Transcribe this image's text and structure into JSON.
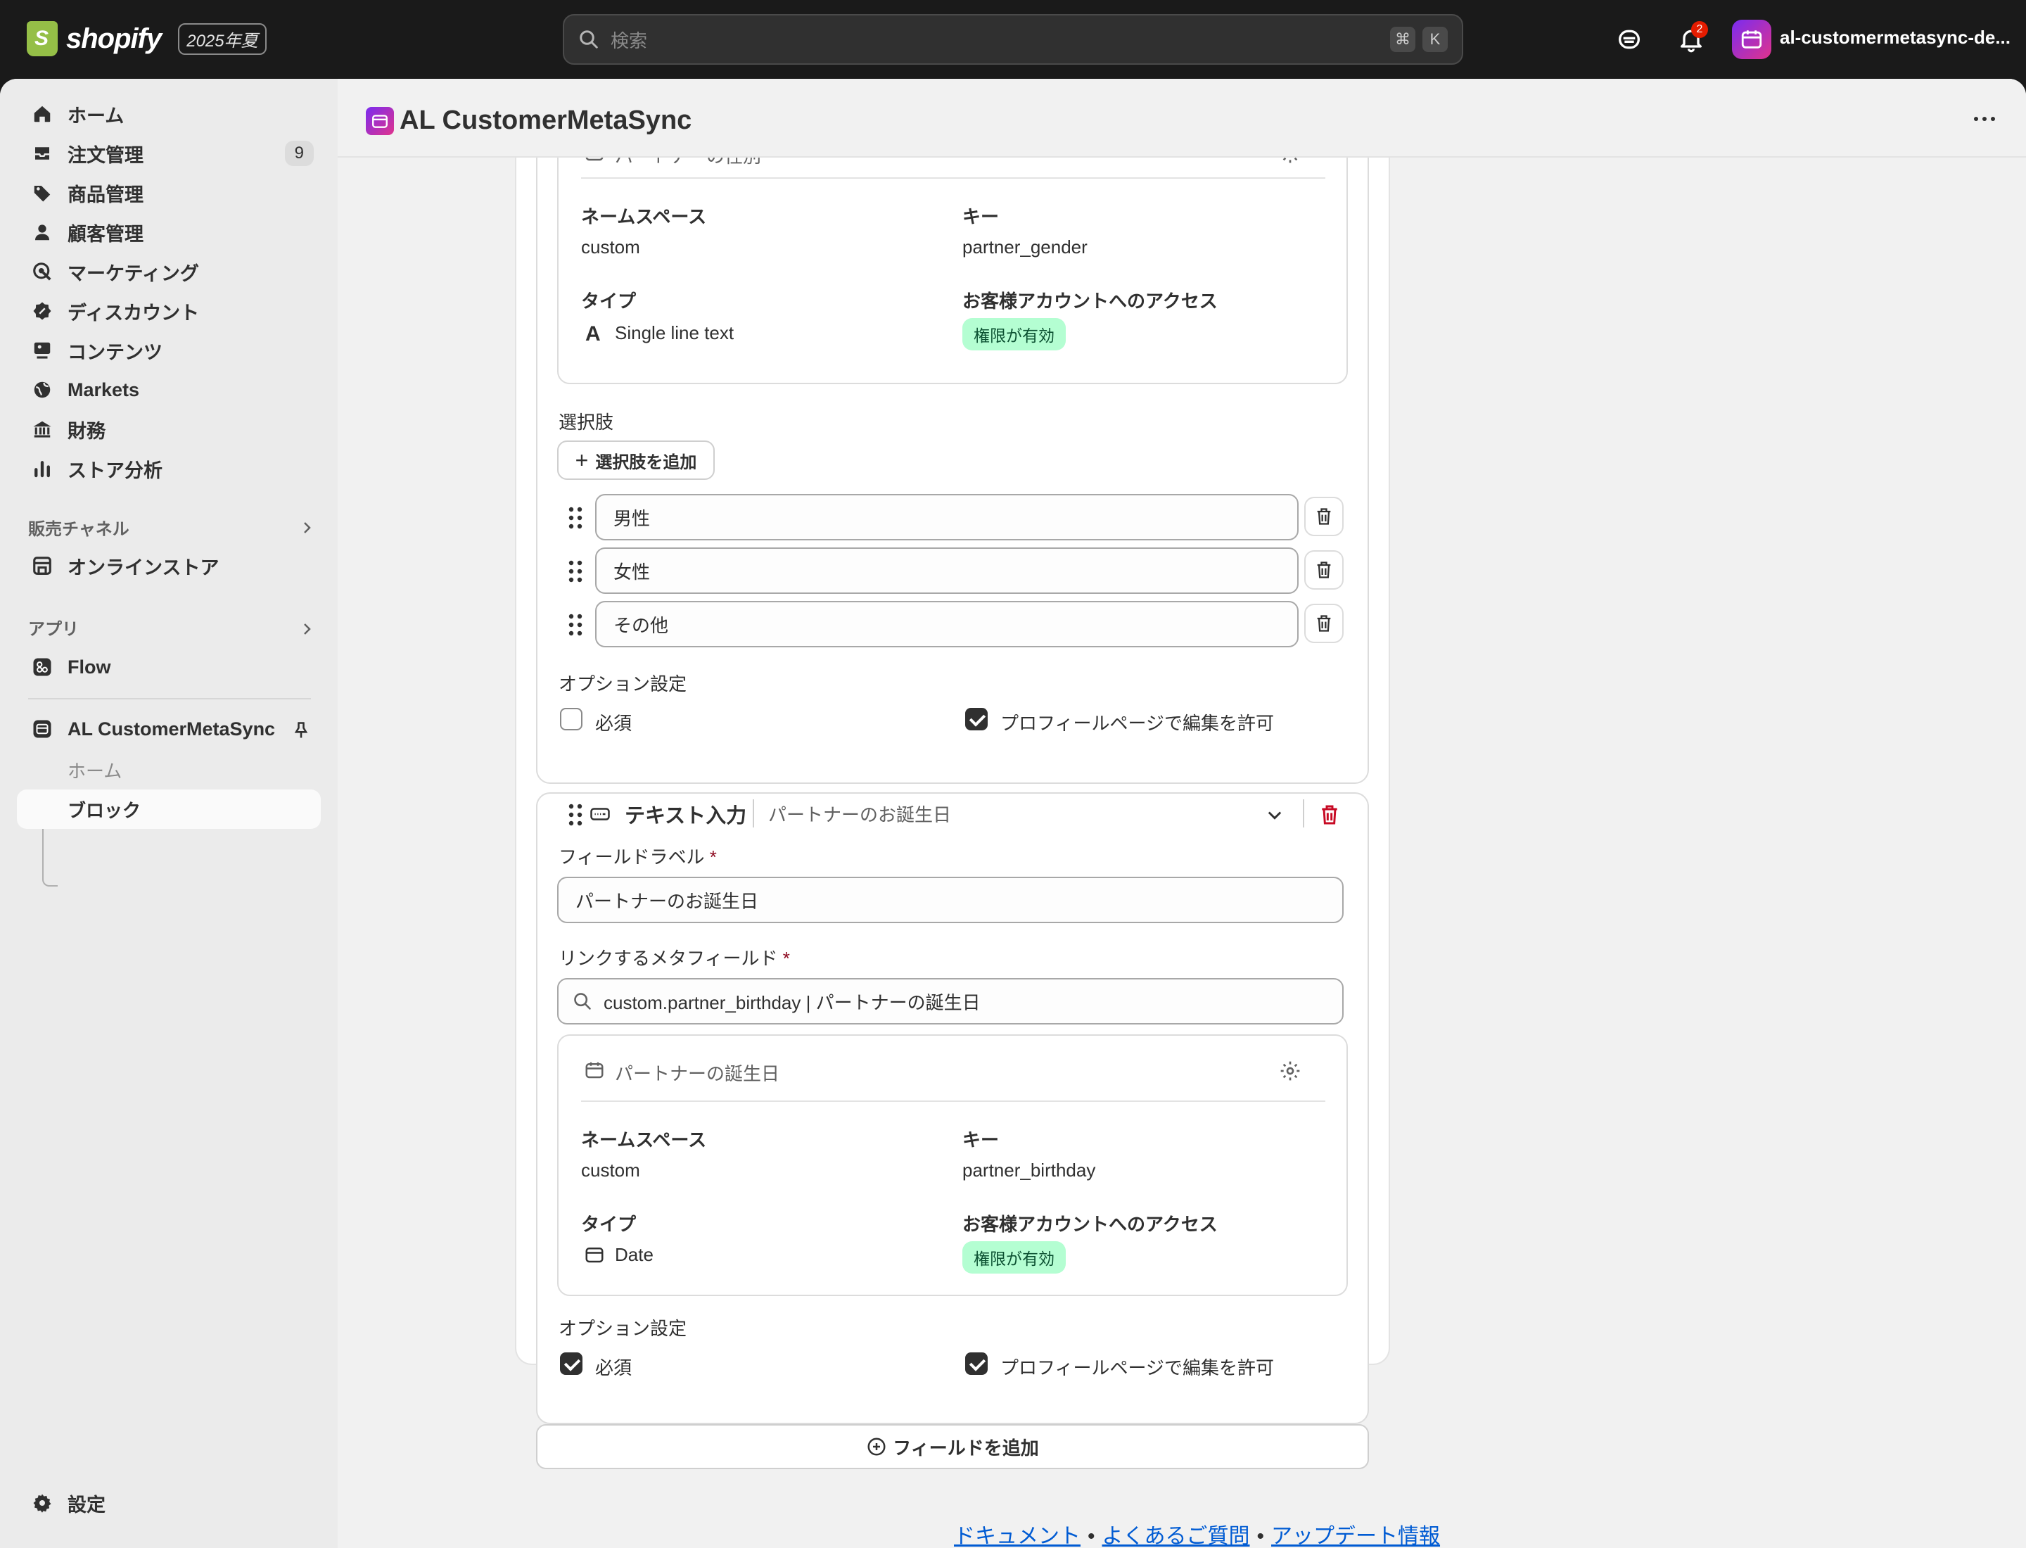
{
  "topbar": {
    "brand": "shopify",
    "edition": "2025年夏",
    "search_placeholder": "検索",
    "kbd1": "⌘",
    "kbd2": "K",
    "notification_count": "2",
    "store_name": "al-customermetasync-de..."
  },
  "sidebar": {
    "items": [
      {
        "label": "ホーム"
      },
      {
        "label": "注文管理",
        "count": "9"
      },
      {
        "label": "商品管理"
      },
      {
        "label": "顧客管理"
      },
      {
        "label": "マーケティング"
      },
      {
        "label": "ディスカウント"
      },
      {
        "label": "コンテンツ"
      },
      {
        "label": "Markets"
      },
      {
        "label": "財務"
      },
      {
        "label": "ストア分析"
      }
    ],
    "sales_channels_label": "販売チャネル",
    "online_store": "オンラインストア",
    "apps_label": "アプリ",
    "flow": "Flow",
    "app_name": "AL CustomerMetaSync",
    "app_sub": [
      {
        "label": "ホーム"
      },
      {
        "label": "ブロック"
      }
    ],
    "settings": "設定"
  },
  "page": {
    "title": "AL CustomerMetaSync"
  },
  "block1": {
    "meta_title": "パートナーの性別",
    "namespace_label": "ネームスペース",
    "namespace": "custom",
    "key_label": "キー",
    "key": "partner_gender",
    "type_label": "タイプ",
    "type": "Single line text",
    "access_label": "お客様アカウントへのアクセス",
    "access": "権限が有効",
    "choices_label": "選択肢",
    "add_choice": "選択肢を追加",
    "choices": [
      "男性",
      "女性",
      "その他"
    ],
    "options_label": "オプション設定",
    "required": "必須",
    "allow_edit": "プロフィールページで編集を許可"
  },
  "block2": {
    "type_title": "テキスト入力",
    "subtitle": "パートナーのお誕生日",
    "field_label_title": "フィールドラベル",
    "field_label_value": "パートナーのお誕生日",
    "metafield_title": "リンクするメタフィールド",
    "metafield_value": "custom.partner_birthday | パートナーの誕生日",
    "meta_title": "パートナーの誕生日",
    "namespace_label": "ネームスペース",
    "namespace": "custom",
    "key_label": "キー",
    "key": "partner_birthday",
    "type_label": "タイプ",
    "type": "Date",
    "access_label": "お客様アカウントへのアクセス",
    "access": "権限が有効",
    "options_label": "オプション設定",
    "required": "必須",
    "allow_edit": "プロフィールページで編集を許可"
  },
  "add_field": "フィールドを追加",
  "footer": {
    "docs": "ドキュメント",
    "faq": "よくあるご質問",
    "updates": "アップデート情報"
  }
}
